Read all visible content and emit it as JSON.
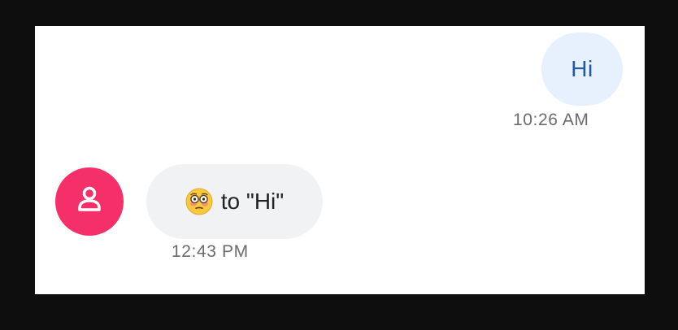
{
  "conversation": {
    "outgoing": {
      "text": "Hi",
      "time": "10:26 AM"
    },
    "incoming": {
      "reaction_emoji": "flushed-face",
      "text": "to \"Hi\"",
      "time": "12:43 PM"
    }
  },
  "icons": {
    "avatar": "person-icon",
    "reaction": "flushed-face-icon"
  },
  "colors": {
    "background": "#0e0e0e",
    "surface": "#ffffff",
    "outgoing_bubble": "#e7f0fd",
    "outgoing_text": "#1f5aa3",
    "incoming_bubble": "#f0f2f3",
    "avatar": "#f42f6a",
    "timestamp": "#6b6b6b"
  }
}
